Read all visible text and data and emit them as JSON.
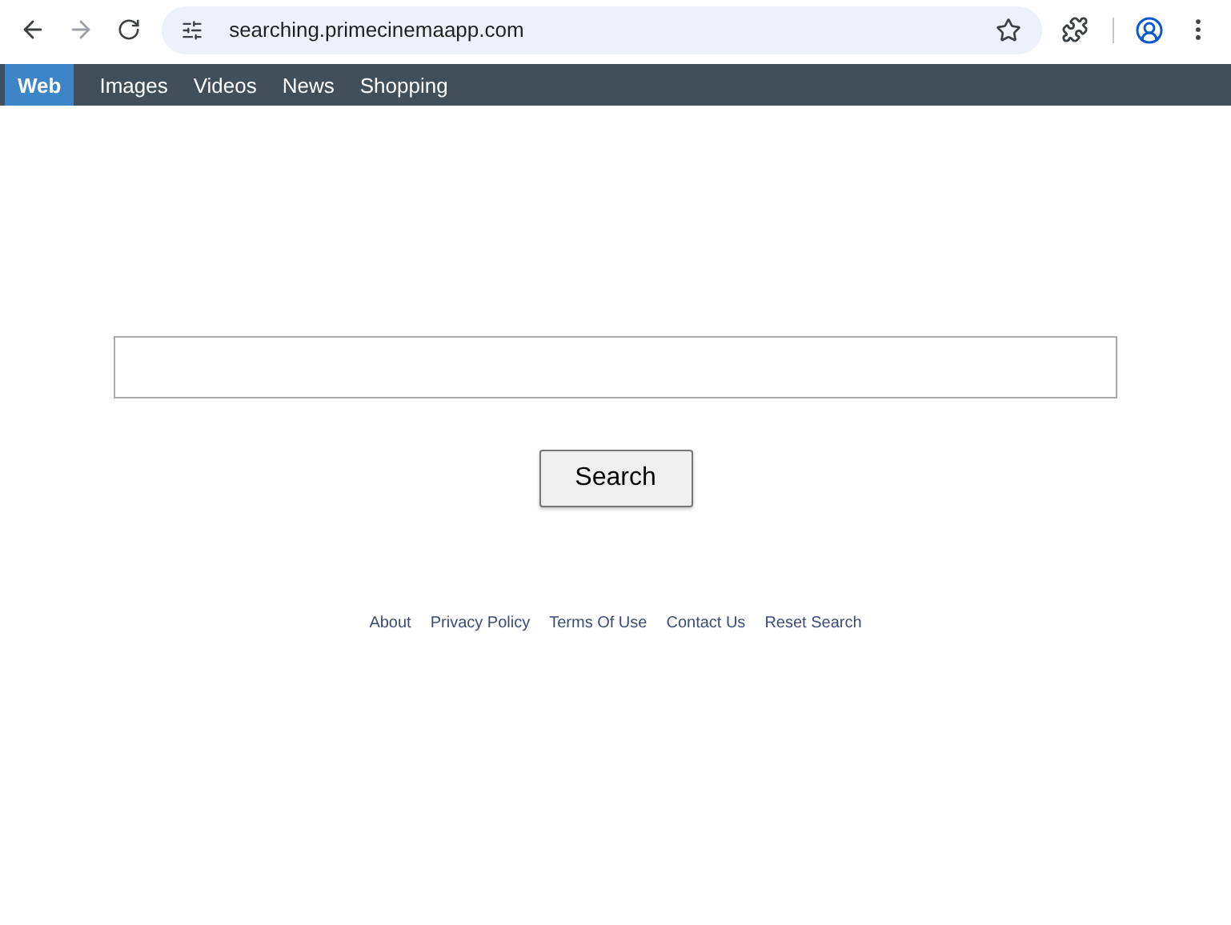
{
  "browser": {
    "address": "searching.primecinemaapp.com",
    "forward_disabled": true
  },
  "tabs": [
    {
      "label": "Web",
      "selected": true
    },
    {
      "label": "Images",
      "selected": false
    },
    {
      "label": "Videos",
      "selected": false
    },
    {
      "label": "News",
      "selected": false
    },
    {
      "label": "Shopping",
      "selected": false
    }
  ],
  "search": {
    "button": "Search"
  },
  "footer_links": [
    "About",
    "Privacy Policy",
    "Terms Of Use",
    "Contact Us",
    "Reset Search"
  ]
}
